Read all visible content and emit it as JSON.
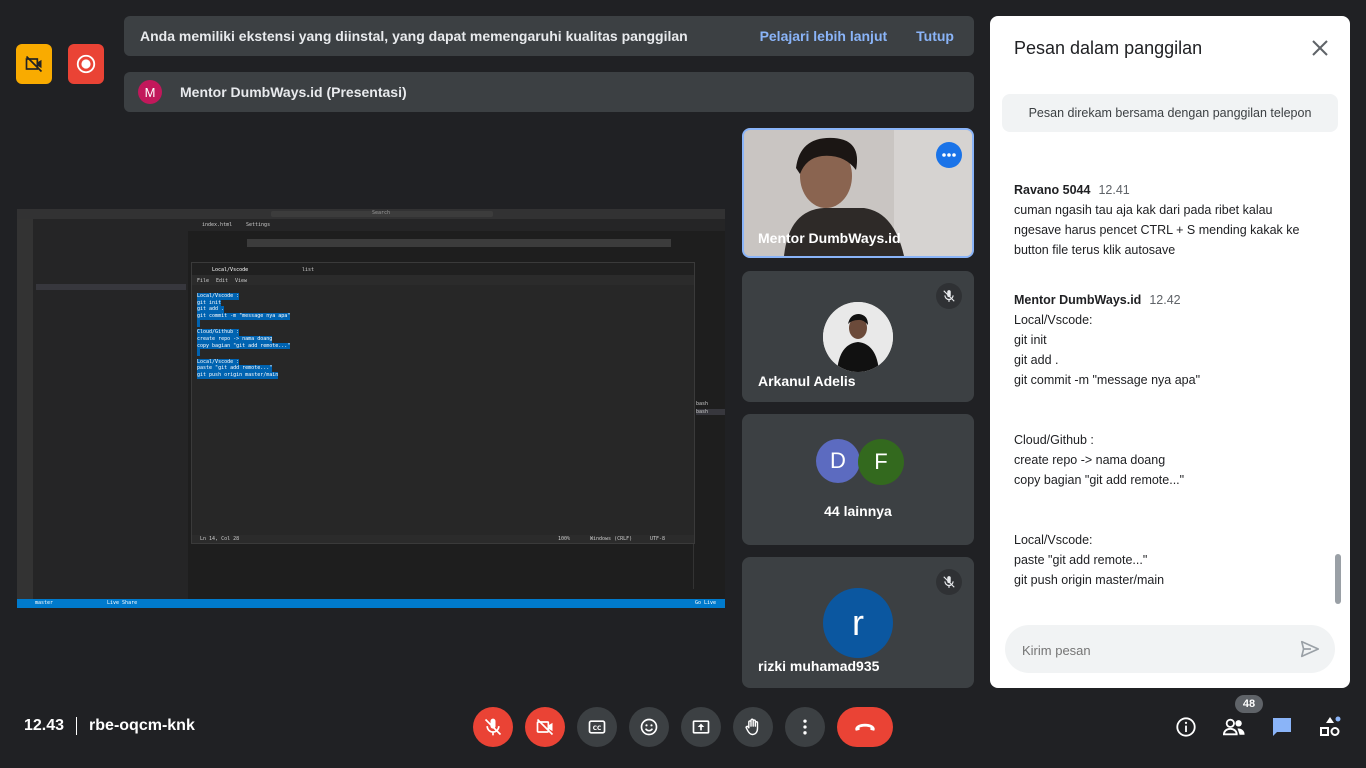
{
  "banner": {
    "message": "Anda memiliki ekstensi yang diinstal, yang dapat memengaruhi kualitas panggilan",
    "learn_more": "Pelajari lebih lanjut",
    "close": "Tutup"
  },
  "presenter": {
    "initial": "M",
    "label": "Mentor DumbWays.id (Presentasi)"
  },
  "shared_screen": {
    "editor_tab1": "index.html",
    "editor_tab2": "Settings",
    "search_hint": "Search",
    "notepad_tab": "Local/Vscode",
    "notepad_tab2": "list",
    "menu": [
      "File",
      "Edit",
      "View"
    ],
    "lines": [
      "Local/Vscode :",
      "git init",
      "git add .",
      "git commit -m \"message nya apa\"",
      "",
      "Cloud/Github :",
      "create repo -> nama doang",
      "copy bagian \"git add remote...\"",
      "",
      "Local/Vscode :",
      "paste \"git add remote...\"",
      "git push origin master/main"
    ],
    "status_left": "Ln 14, Col 28",
    "status_zoom": "100%",
    "status_eol": "Windows (CRLF)",
    "status_enc": "UTF-8",
    "statusbar_branch": "master",
    "statusbar_live": "Live Share",
    "statusbar_golive": "Go Live",
    "terminal_items": [
      "bash",
      "bash"
    ]
  },
  "tiles": [
    {
      "name": "Mentor DumbWays.id"
    },
    {
      "name": "Arkanul Adelis"
    },
    {
      "name": "44 lainnya",
      "initials": [
        "D",
        "F"
      ]
    },
    {
      "name": "rizki muhamad935",
      "initial": "r"
    }
  ],
  "chat": {
    "title": "Pesan dalam panggilan",
    "notice": "Pesan direkam bersama dengan panggilan telepon",
    "messages": [
      {
        "sender": "Ravano 5044",
        "time": "12.41",
        "text": "cuman ngasih tau aja kak dari pada ribet kalau ngesave harus pencet CTRL + S mending kakak ke button file terus klik autosave"
      },
      {
        "sender": "Mentor DumbWays.id",
        "time": "12.42",
        "lines": [
          "Local/Vscode:",
          "git init",
          "git add .",
          "git commit -m \"message nya apa\"",
          "",
          "",
          "Cloud/Github :",
          "create repo -> nama doang",
          "copy bagian \"git add remote...\"",
          "",
          "",
          "Local/Vscode:",
          "paste \"git add remote...\"",
          "git push origin master/main"
        ]
      }
    ],
    "input_placeholder": "Kirim pesan"
  },
  "meeting": {
    "time": "12.43",
    "code": "rbe-oqcm-knk"
  },
  "participants_count": "48",
  "colors": {
    "background": "#202124",
    "danger": "#ea4335",
    "link": "#8ab4f8",
    "chat_active": "#8ab4f8"
  }
}
